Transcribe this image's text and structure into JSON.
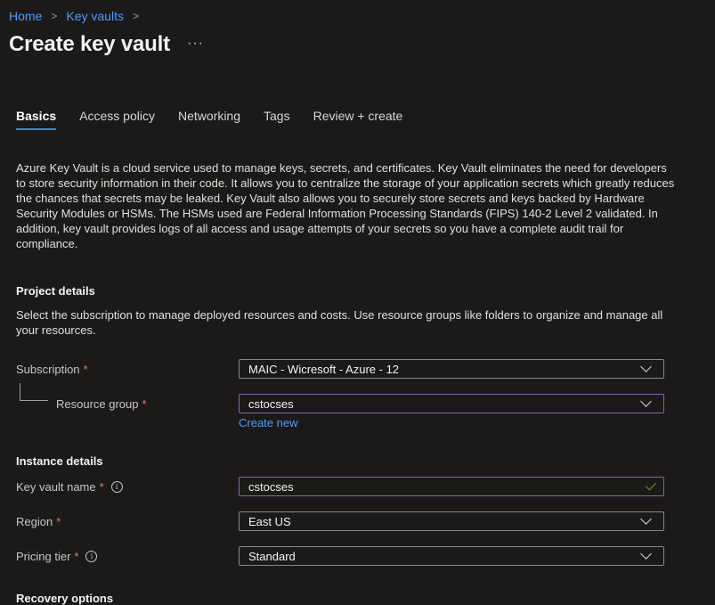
{
  "breadcrumb": {
    "home": "Home",
    "key_vaults": "Key vaults",
    "sep": ">"
  },
  "page": {
    "title": "Create key vault",
    "more": "···"
  },
  "tabs": [
    {
      "label": "Basics",
      "active": true
    },
    {
      "label": "Access policy"
    },
    {
      "label": "Networking"
    },
    {
      "label": "Tags"
    },
    {
      "label": "Review + create"
    }
  ],
  "description": "Azure Key Vault is a cloud service used to manage keys, secrets, and certificates. Key Vault eliminates the need for developers to store security information in their code. It allows you to centralize the storage of your application secrets which greatly reduces the chances that secrets may be leaked. Key Vault also allows you to securely store secrets and keys backed by Hardware Security Modules or HSMs. The HSMs used are Federal Information Processing Standards (FIPS) 140-2 Level 2 validated. In addition, key vault provides logs of all access and usage attempts of your secrets so you have a complete audit trail for compliance.",
  "project": {
    "heading": "Project details",
    "text": "Select the subscription to manage deployed resources and costs. Use resource groups like folders to organize and manage all your resources.",
    "subscription_label": "Subscription",
    "subscription_value": "MAIC - Wicresoft - Azure - 12",
    "resource_group_label": "Resource group",
    "resource_group_value": "cstocses",
    "create_new": "Create new"
  },
  "instance": {
    "heading": "Instance details",
    "name_label": "Key vault name",
    "name_value": "cstocses",
    "region_label": "Region",
    "region_value": "East US",
    "pricing_label": "Pricing tier",
    "pricing_value": "Standard"
  },
  "recovery": {
    "heading": "Recovery options"
  },
  "required_mark": "*",
  "info_glyph": "i",
  "colors": {
    "accent": "#2b88d8",
    "link": "#4f9bff",
    "required": "#f1707b",
    "valid": "#57a300",
    "focus_border": "#8764b8"
  }
}
